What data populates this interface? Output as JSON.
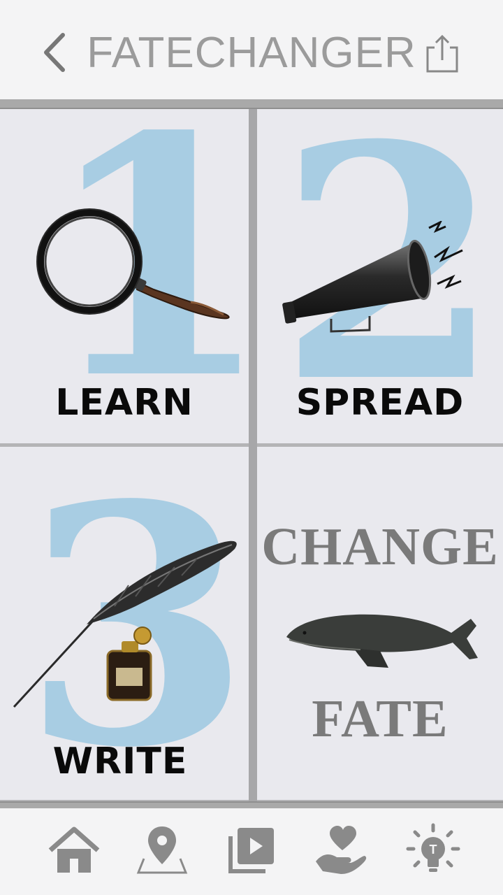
{
  "header": {
    "title": "FATECHANGER",
    "back_icon": "chevron-left-icon",
    "share_icon": "share-icon"
  },
  "tiles": [
    {
      "number": "1",
      "label": "LEARN",
      "icon": "magnifying-glass-icon"
    },
    {
      "number": "2",
      "label": "SPREAD",
      "icon": "megaphone-icon"
    },
    {
      "number": "3",
      "label": "WRITE",
      "icon": "quill-and-ink-icon"
    },
    {
      "top_word": "CHANGE",
      "bottom_word": "FATE",
      "icon": "whale-icon"
    }
  ],
  "bottom_nav": {
    "items": [
      {
        "icon": "home-icon"
      },
      {
        "icon": "map-pin-icon"
      },
      {
        "icon": "video-library-icon"
      },
      {
        "icon": "heart-hand-icon"
      },
      {
        "icon": "lightbulb-icon"
      }
    ]
  },
  "colors": {
    "number_blue": "#a8cde3",
    "header_text": "#9b9b9b",
    "label_black": "#0a0a0a",
    "serif_gray": "#7a7a7a",
    "tile_bg": "#e9e9ee"
  }
}
